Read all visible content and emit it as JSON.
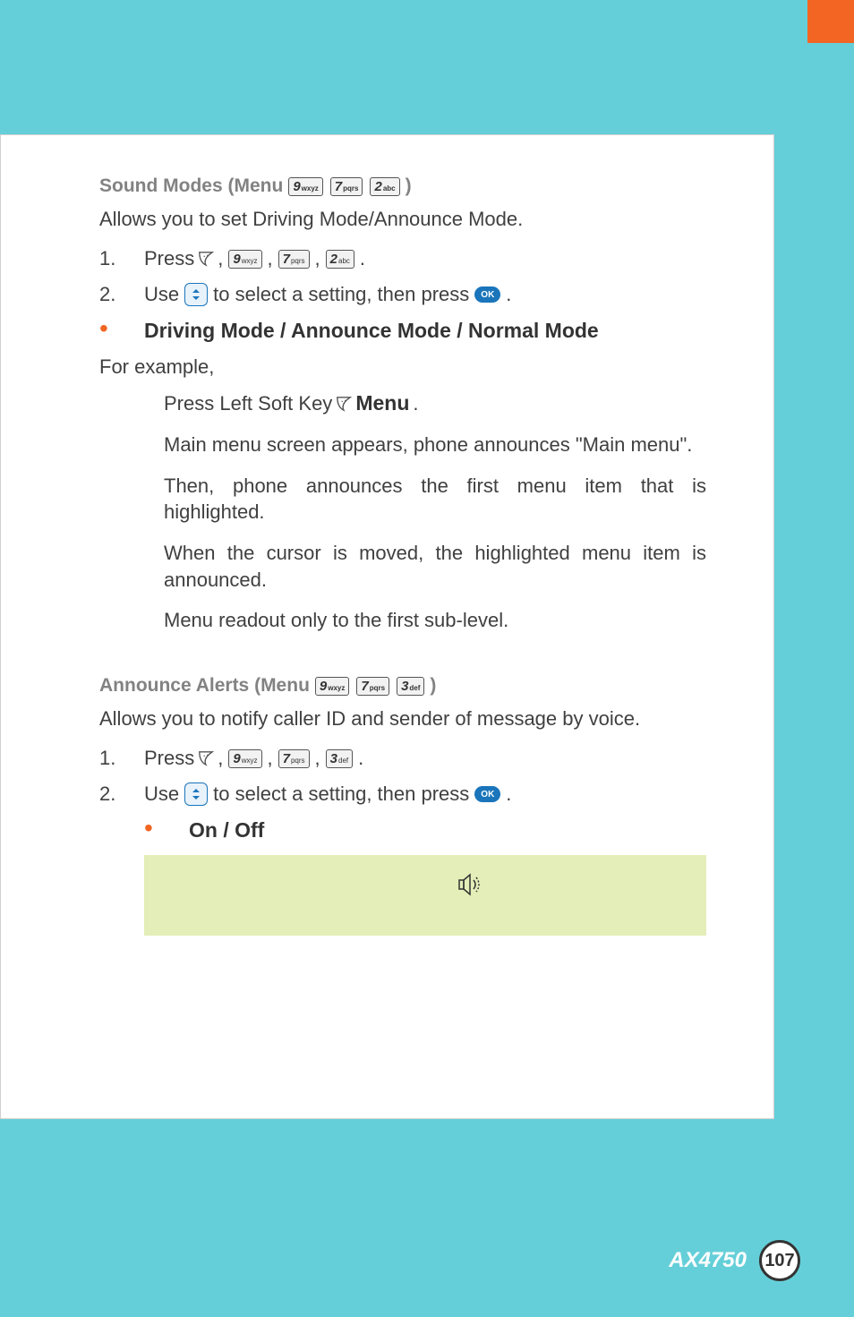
{
  "section1": {
    "heading_prefix": "Sound Modes (Menu ",
    "heading_suffix": " )",
    "keys": [
      {
        "num": "9",
        "sub": "wxyz"
      },
      {
        "num": "7",
        "sub": "pqrs"
      },
      {
        "num": "2",
        "sub": "abc"
      }
    ],
    "intro": "Allows you to set Driving Mode/Announce Mode.",
    "step1_num": "1.",
    "step1_label": "Press ",
    "step1_keys": [
      {
        "num": "9",
        "sub": "wxyz"
      },
      {
        "num": "7",
        "sub": "pqrs"
      },
      {
        "num": "2",
        "sub": "abc"
      }
    ],
    "step2_num": "2.",
    "step2_a": "Use ",
    "step2_b": " to select a setting, then press ",
    "step2_c": " .",
    "modes": "Driving Mode / Announce Mode / Normal Mode",
    "for_example": "For example,",
    "ex1_a": "Press Left Soft Key ",
    "ex1_b": " Menu",
    "ex1_c": ".",
    "ex2": "Main menu screen appears, phone announces \"Main menu\".",
    "ex3": "Then, phone announces the first menu item that is highlighted.",
    "ex4": "When the cursor is moved, the highlighted menu item is announced.",
    "ex5": "Menu readout only to the first sub-level."
  },
  "section2": {
    "heading_prefix": "Announce Alerts (Menu ",
    "heading_suffix": " )",
    "keys": [
      {
        "num": "9",
        "sub": "wxyz"
      },
      {
        "num": "7",
        "sub": "pqrs"
      },
      {
        "num": "3",
        "sub": "def"
      }
    ],
    "intro": "Allows you to notify caller ID and sender of message by voice.",
    "step1_num": "1.",
    "step1_label": "Press ",
    "step1_keys": [
      {
        "num": "9",
        "sub": "wxyz"
      },
      {
        "num": "7",
        "sub": "pqrs"
      },
      {
        "num": "3",
        "sub": "def"
      }
    ],
    "step2_num": "2.",
    "step2_a": "Use ",
    "step2_b": " to select a setting, then press ",
    "step2_c": ".",
    "options": "On / Off"
  },
  "ok_label": "OK",
  "footer": {
    "model": "AX4750",
    "page": "107"
  }
}
